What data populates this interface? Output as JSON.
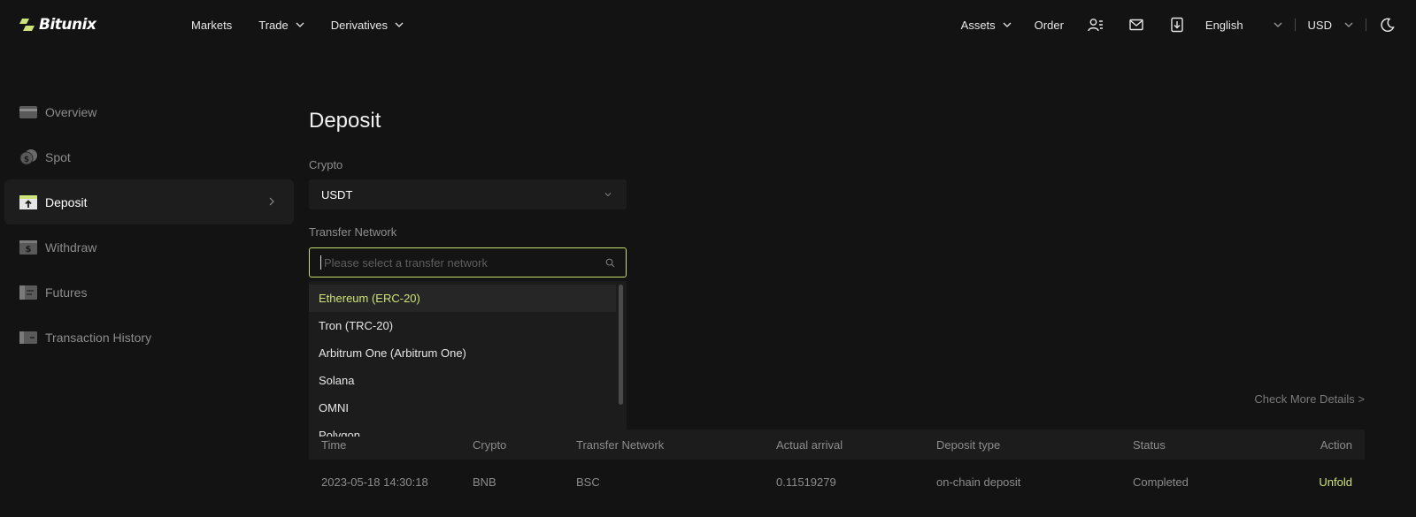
{
  "brand": {
    "name": "Bitunix",
    "accent": "#cde27a"
  },
  "nav": {
    "left": [
      {
        "label": "Markets",
        "has_chevron": false
      },
      {
        "label": "Trade",
        "has_chevron": true
      },
      {
        "label": "Derivatives",
        "has_chevron": true
      }
    ],
    "assets": "Assets",
    "order": "Order",
    "icons": [
      "user-icon",
      "mail-icon",
      "download-icon"
    ],
    "language": "English",
    "currency": "USD",
    "theme_icon": "moon-icon"
  },
  "sidebar": {
    "items": [
      {
        "label": "Overview",
        "icon": "card-icon",
        "active": false
      },
      {
        "label": "Spot",
        "icon": "coins-icon",
        "active": false
      },
      {
        "label": "Deposit",
        "icon": "deposit-icon",
        "active": true
      },
      {
        "label": "Withdraw",
        "icon": "withdraw-icon",
        "active": false
      },
      {
        "label": "Futures",
        "icon": "futures-icon",
        "active": false
      },
      {
        "label": "Transaction History",
        "icon": "history-icon",
        "active": false
      }
    ]
  },
  "main": {
    "title": "Deposit",
    "crypto_label": "Crypto",
    "crypto_value": "USDT",
    "network_label": "Transfer Network",
    "network_placeholder": "Please select a transfer network",
    "network_options": [
      "Ethereum (ERC-20)",
      "Tron (TRC-20)",
      "Arbitrum One (Arbitrum One)",
      "Solana",
      "OMNI",
      "Polygon"
    ],
    "network_highlighted": "Ethereum (ERC-20)"
  },
  "records": {
    "check_more": "Check More Details >",
    "headers": [
      "Time",
      "Crypto",
      "Transfer Network",
      "Actual arrival",
      "Deposit type",
      "Status",
      "Action"
    ],
    "rows": [
      [
        "2023-05-18 14:30:18",
        "BNB",
        "BSC",
        "0.11519279",
        "on-chain deposit",
        "Completed",
        "Unfold"
      ]
    ]
  }
}
